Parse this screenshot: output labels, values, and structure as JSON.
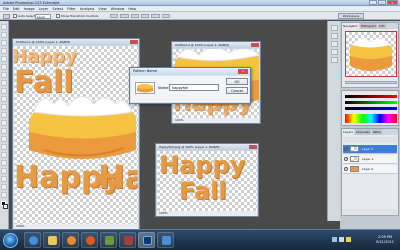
{
  "app": {
    "title": "Adobe Photoshop CS3 Extended"
  },
  "menu": [
    "File",
    "Edit",
    "Image",
    "Layer",
    "Select",
    "Filter",
    "Analysis",
    "View",
    "Window",
    "Help"
  ],
  "options_bar": {
    "auto_select": "Auto-Select:",
    "auto_select_value": "Layer",
    "transform": "Show Transform Controls",
    "workspace": "Workspace"
  },
  "documents": [
    {
      "title": "Untitled-1 @ 100% (Layer 1, RGB/8)",
      "status": "100%",
      "text": [
        "Fall",
        "Happy",
        "Ha"
      ]
    },
    {
      "title": "Untitled-2 @ 100% (Layer 1, RGB/8)",
      "status": "100%",
      "text": [
        "Ha",
        "Happy"
      ]
    },
    {
      "title": "HappyFall.png @ 100% (Layer 1, RGB/8)",
      "status": "100%",
      "text": [
        "Happy",
        "Fall"
      ]
    }
  ],
  "dialog": {
    "title": "Pattern Name",
    "name_label": "Name:",
    "name_value": "happyfall",
    "ok": "OK",
    "cancel": "Cancel"
  },
  "right_panel": {
    "nav_tabs": [
      "Navigator",
      "Histogram",
      "Info"
    ],
    "layers_tabs": [
      "Layers",
      "Channels",
      "Paths"
    ],
    "layers": [
      {
        "name": "Layer 2",
        "selected": true
      },
      {
        "name": "Layer 1",
        "selected": false
      },
      {
        "name": "Layer 0",
        "selected": false
      }
    ]
  },
  "taskbar": {
    "time": "2:09 PM",
    "date": "9/21/2011"
  },
  "colors": {
    "accent_orange": "#e59a45",
    "candy_white": "#ffffff",
    "candy_yellow": "#f5c242",
    "candy_orange": "#eb9a3e",
    "selection_blue": "#3d7fd6"
  }
}
